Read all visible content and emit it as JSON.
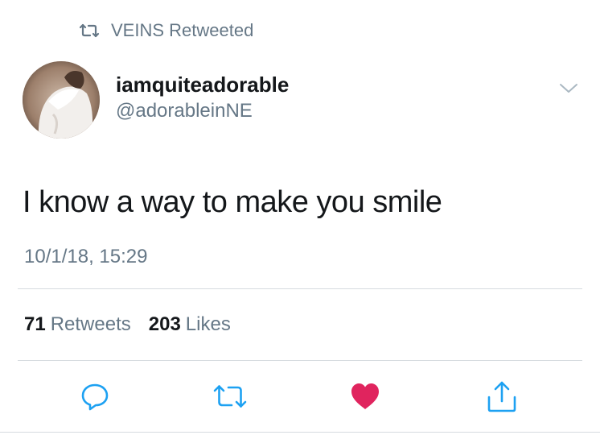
{
  "retweet_banner": {
    "icon": "retweet-icon",
    "text": "VEINS Retweeted"
  },
  "author": {
    "display_name": "iamquiteadorable",
    "handle": "@adorableinNE",
    "avatar": "avatar-image"
  },
  "menu": {
    "icon": "chevron-down-icon"
  },
  "tweet": {
    "text": "I know a way to make you smile",
    "timestamp": "10/1/18, 15:29"
  },
  "stats": {
    "retweets_count": "71",
    "retweets_label": "Retweets",
    "likes_count": "203",
    "likes_label": "Likes"
  },
  "actions": [
    {
      "name": "reply",
      "icon": "reply-icon"
    },
    {
      "name": "retweet",
      "icon": "retweet-icon"
    },
    {
      "name": "like",
      "icon": "heart-icon",
      "active": true
    },
    {
      "name": "share",
      "icon": "share-icon"
    }
  ],
  "colors": {
    "secondary_text": "#657786",
    "primary_text": "#14171a",
    "like_active": "#e0245e",
    "divider": "#d6dbdf"
  }
}
